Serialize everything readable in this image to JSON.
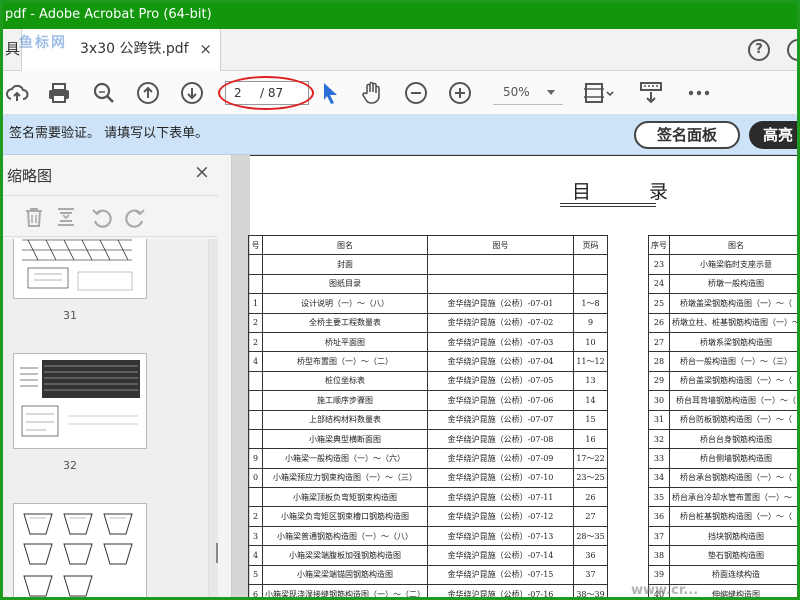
{
  "window": {
    "title": "pdf - Adobe Acrobat Pro (64-bit)"
  },
  "tabs": {
    "left_stub": "具",
    "active_title": "3x30 公跨铁.pdf",
    "close": "×"
  },
  "toolbar": {
    "page_current": "2",
    "page_total": "/ 87",
    "zoom": "50%"
  },
  "banner": {
    "message": "签名需要验证。 请填写以下表单。",
    "sign_panel": "签名面板",
    "highlight": "高亮"
  },
  "thumbnails": {
    "title": "缩略图",
    "close": "×",
    "pages": [
      "31",
      "32"
    ]
  },
  "document": {
    "title": "目 录",
    "left_headers": [
      "号",
      "图名",
      "图号",
      "页码"
    ],
    "left_rows": [
      [
        "",
        "封面",
        "",
        ""
      ],
      [
        "",
        "图纸目录",
        "",
        ""
      ],
      [
        "1",
        "设计说明（一）～（八）",
        "金华绕沪昆施（公桥）-07-01",
        "1～8"
      ],
      [
        "2",
        "全桥主要工程数量表",
        "金华绕沪昆施（公桥）-07-02",
        "9"
      ],
      [
        "2",
        "桥址平面图",
        "金华绕沪昆施（公桥）-07-03",
        "10"
      ],
      [
        "4",
        "桥型布置图（一）～（二）",
        "金华绕沪昆施（公桥）-07-04",
        "11～12"
      ],
      [
        "",
        "桩位坐标表",
        "金华绕沪昆施（公桥）-07-05",
        "13"
      ],
      [
        "",
        "施工顺序步骤图",
        "金华绕沪昆施（公桥）-07-06",
        "14"
      ],
      [
        "",
        "上部结构材料数量表",
        "金华绕沪昆施（公桥）-07-07",
        "15"
      ],
      [
        "",
        "小箱梁典型横断面图",
        "金华绕沪昆施（公桥）-07-08",
        "16"
      ],
      [
        "9",
        "小箱梁一般构造图（一）～（六）",
        "金华绕沪昆施（公桥）-07-09",
        "17～22"
      ],
      [
        "0",
        "小箱梁预应力钢束构造图（一）～（三）",
        "金华绕沪昆施（公桥）-07-10",
        "23～25"
      ],
      [
        "",
        "小箱梁顶板负弯矩钢束构造图",
        "金华绕沪昆施（公桥）-07-11",
        "26"
      ],
      [
        "2",
        "小箱梁负弯矩区钢束槽口钢筋构造图",
        "金华绕沪昆施（公桥）-07-12",
        "27"
      ],
      [
        "3",
        "小箱梁普通钢筋构造图（一）～（八）",
        "金华绕沪昆施（公桥）-07-13",
        "28～35"
      ],
      [
        "4",
        "小箱梁梁端腹板加强钢筋构造图",
        "金华绕沪昆施（公桥）-07-14",
        "36"
      ],
      [
        "5",
        "小箱梁梁端锚固钢筋构造图",
        "金华绕沪昆施（公桥）-07-15",
        "37"
      ],
      [
        "6",
        "小箱梁现浇湿接缝钢筋构造图（一）～（二）",
        "金华绕沪昆施（公桥）-07-16",
        "38～39"
      ]
    ],
    "right_headers": [
      "序号",
      "图名"
    ],
    "right_rows": [
      [
        "23",
        "小箱梁临时支座示意"
      ],
      [
        "24",
        "桥墩一般构造图"
      ],
      [
        "25",
        "桥墩盖梁钢筋构造图（一）～（"
      ],
      [
        "26",
        "桥墩立柱、桩基钢筋构造图（一）～"
      ],
      [
        "27",
        "桥墩系梁钢筋构造图"
      ],
      [
        "28",
        "桥台一般构造图（一）～（三）"
      ],
      [
        "29",
        "桥台盖梁钢筋构造图（一）～（"
      ],
      [
        "30",
        "桥台耳背墙钢筋构造图（一）～（"
      ],
      [
        "31",
        "桥台防板钢筋构造图（一）～（"
      ],
      [
        "32",
        "桥台台身钢筋构造图"
      ],
      [
        "33",
        "桥台侧墙钢筋构造图"
      ],
      [
        "34",
        "桥台承台钢筋构造图（一）～（"
      ],
      [
        "35",
        "桥台承台冷却水管布置图（一）～（"
      ],
      [
        "36",
        "桥台桩基钢筋构造图（一）～（"
      ],
      [
        "37",
        "挡块钢筋构造图"
      ],
      [
        "38",
        "垫石钢筋构造图"
      ],
      [
        "39",
        "桥面连续构造"
      ],
      [
        "40",
        "伸缩缝构造图"
      ]
    ]
  },
  "watermarks": {
    "top_left": "鱼标网",
    "bottom_right": "www.cr..."
  }
}
